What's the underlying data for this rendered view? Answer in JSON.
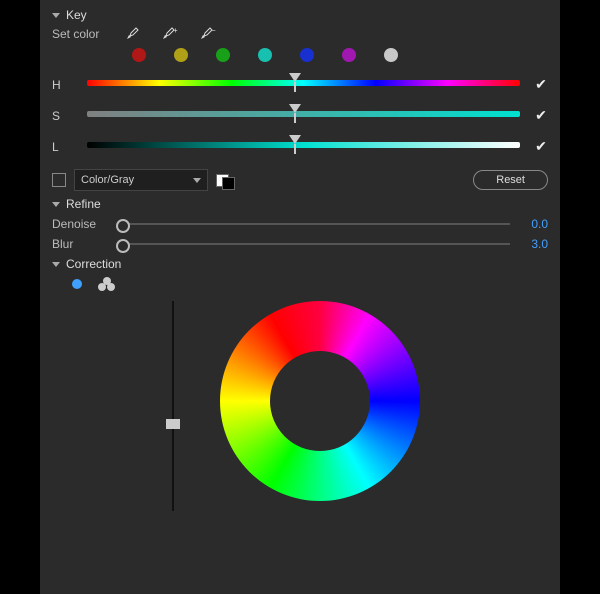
{
  "key": {
    "title": "Key",
    "setColorLabel": "Set color",
    "hLabel": "H",
    "sLabel": "S",
    "lLabel": "L",
    "colorGrayValue": "Color/Gray",
    "resetLabel": "Reset",
    "swatches": [
      "#b01818",
      "#b0a018",
      "#18a018",
      "#18c0b0",
      "#1830d0",
      "#a018b0",
      "#c8c8c8"
    ],
    "hChecked": true,
    "sChecked": true,
    "lChecked": true
  },
  "refine": {
    "title": "Refine",
    "denoiseLabel": "Denoise",
    "denoiseValue": "0.0",
    "blurLabel": "Blur",
    "blurValue": "3.0"
  },
  "correction": {
    "title": "Correction"
  }
}
